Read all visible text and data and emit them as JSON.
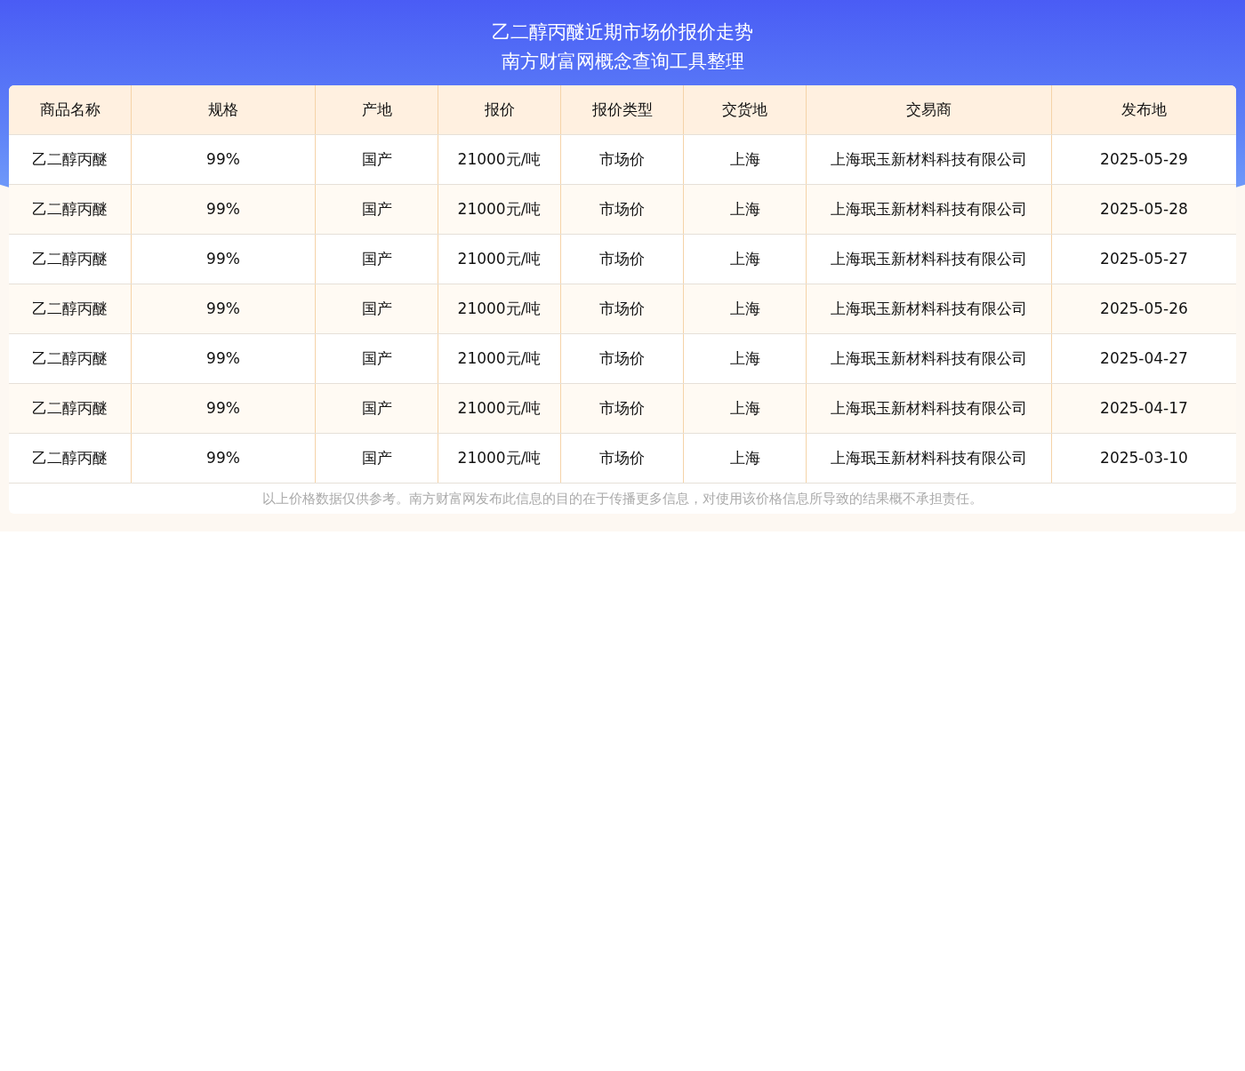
{
  "title": [
    "乙二醇丙醚近期市场价报价走势",
    "南方财富网概念查询工具整理"
  ],
  "table": {
    "columns": [
      "商品名称",
      "规格",
      "产地",
      "报价",
      "报价类型",
      "交货地",
      "交易商",
      "发布地"
    ],
    "rows": [
      [
        "乙二醇丙醚",
        "99%",
        "国产",
        "21000元/吨",
        "市场价",
        "上海",
        "上海珉玉新材料科技有限公司",
        "2025-05-29"
      ],
      [
        "乙二醇丙醚",
        "99%",
        "国产",
        "21000元/吨",
        "市场价",
        "上海",
        "上海珉玉新材料科技有限公司",
        "2025-05-28"
      ],
      [
        "乙二醇丙醚",
        "99%",
        "国产",
        "21000元/吨",
        "市场价",
        "上海",
        "上海珉玉新材料科技有限公司",
        "2025-05-27"
      ],
      [
        "乙二醇丙醚",
        "99%",
        "国产",
        "21000元/吨",
        "市场价",
        "上海",
        "上海珉玉新材料科技有限公司",
        "2025-05-26"
      ],
      [
        "乙二醇丙醚",
        "99%",
        "国产",
        "21000元/吨",
        "市场价",
        "上海",
        "上海珉玉新材料科技有限公司",
        "2025-04-27"
      ],
      [
        "乙二醇丙醚",
        "99%",
        "国产",
        "21000元/吨",
        "市场价",
        "上海",
        "上海珉玉新材料科技有限公司",
        "2025-04-17"
      ],
      [
        "乙二醇丙醚",
        "99%",
        "国产",
        "21000元/吨",
        "市场价",
        "上海",
        "上海珉玉新材料科技有限公司",
        "2025-03-10"
      ]
    ]
  },
  "footer": "以上价格数据仅供参考。南方财富网发布此信息的目的在于传播更多信息，对使用该价格信息所导致的结果概不承担责任。"
}
